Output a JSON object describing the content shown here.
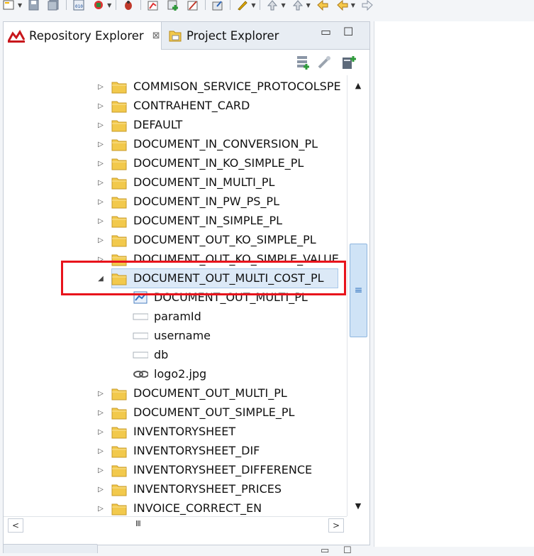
{
  "tabs": {
    "repository_explorer": "Repository Explorer",
    "project_explorer": "Project Explorer",
    "close_glyph": "⊠",
    "minimize_glyph": "▭",
    "maximize_glyph": "☐"
  },
  "toolbar_icons": [
    "new-file-icon",
    "save-icon",
    "save-all-icon",
    "binary-icon",
    "run-config-icon",
    "debug-icon",
    "chart-edit-icon",
    "add-dataset-icon",
    "edit-chart-icon",
    "export-icon",
    "pen-icon",
    "prev-annotation-icon",
    "next-annotation-icon",
    "back-icon",
    "back-nav-icon",
    "forward-icon"
  ],
  "tree": {
    "items_before": [
      {
        "label": "COMMISON_SERVICE_PROTOCOLSPE"
      },
      {
        "label": "CONTRAHENT_CARD"
      },
      {
        "label": "DEFAULT"
      },
      {
        "label": "DOCUMENT_IN_CONVERSION_PL"
      },
      {
        "label": "DOCUMENT_IN_KO_SIMPLE_PL"
      },
      {
        "label": "DOCUMENT_IN_MULTI_PL"
      },
      {
        "label": "DOCUMENT_IN_PW_PS_PL"
      },
      {
        "label": "DOCUMENT_IN_SIMPLE_PL"
      },
      {
        "label": "DOCUMENT_OUT_KO_SIMPLE_PL"
      },
      {
        "label": "DOCUMENT_OUT_KO_SIMPLE_VALUE"
      }
    ],
    "expanded": {
      "label": "DOCUMENT_OUT_MULTI_COST_PL",
      "children": [
        {
          "label": "DOCUMENT_OUT_MULTI_PL",
          "icon": "report-icon"
        },
        {
          "label": "paramId",
          "icon": "parameter-icon"
        },
        {
          "label": "username",
          "icon": "parameter-icon"
        },
        {
          "label": "db",
          "icon": "parameter-icon"
        },
        {
          "label": "logo2.jpg",
          "icon": "link-icon"
        }
      ]
    },
    "items_after": [
      {
        "label": "DOCUMENT_OUT_MULTI_PL"
      },
      {
        "label": "DOCUMENT_OUT_SIMPLE_PL"
      },
      {
        "label": "INVENTORYSHEET"
      },
      {
        "label": "INVENTORYSHEET_DIF"
      },
      {
        "label": "INVENTORYSHEET_DIFFERENCE"
      },
      {
        "label": "INVENTORYSHEET_PRICES"
      },
      {
        "label": "INVOICE_CORRECT_EN"
      }
    ]
  },
  "scrollbar": {
    "vertical_grip": "≡",
    "horizontal_grip": "III",
    "left": "<",
    "right": ">"
  },
  "colors": {
    "accent_red": "#e8131c",
    "selection": "#dce9f7",
    "folder": "#f2c94c"
  }
}
